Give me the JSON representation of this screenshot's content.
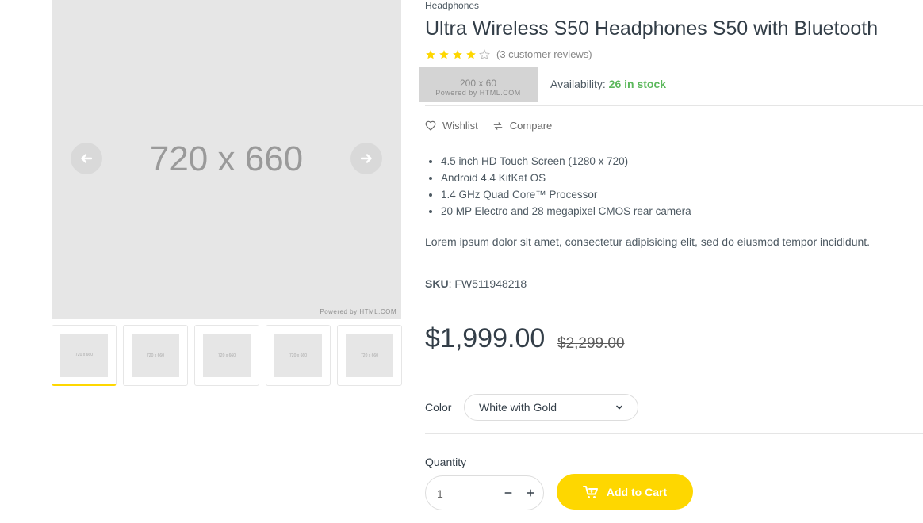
{
  "gallery": {
    "main_image_text": "720 x 660",
    "main_image_powered": "Powered by HTML.COM",
    "prev_icon": "arrow-left-icon",
    "next_icon": "arrow-right-icon",
    "thumbnails": [
      {
        "label": "720 x 660",
        "active": true
      },
      {
        "label": "720 x 660",
        "active": false
      },
      {
        "label": "720 x 660",
        "active": false
      },
      {
        "label": "720 x 660",
        "active": false
      },
      {
        "label": "720 x 660",
        "active": false
      }
    ]
  },
  "product": {
    "category": "Headphones",
    "title": "Ultra Wireless S50 Headphones S50 with Bluetooth",
    "rating": 4,
    "rating_max": 5,
    "reviews": "(3 customer reviews)",
    "brand_placeholder_size": "200 x 60",
    "brand_placeholder_powered": "Powered by HTML.COM",
    "availability_label": "Availability:",
    "availability_value": "26 in stock",
    "wishlist_label": "Wishlist",
    "compare_label": "Compare",
    "features": [
      "4.5 inch HD Touch Screen (1280 x 720)",
      "Android 4.4 KitKat OS",
      "1.4 GHz Quad Core™ Processor",
      "20 MP Electro and 28 megapixel CMOS rear camera"
    ],
    "description": "Lorem ipsum dolor sit amet, consectetur adipisicing elit, sed do eiusmod tempor incididunt.",
    "sku_label": "SKU",
    "sku_value": ": FW511948218",
    "price": "$1,999.00",
    "old_price": "$2,299.00",
    "color_label": "Color",
    "color_selected": "White with Gold",
    "quantity_label": "Quantity",
    "quantity_value": "1",
    "add_to_cart_label": "Add to Cart"
  },
  "colors": {
    "accent": "#fed700",
    "stock": "#5cb85c",
    "star": "#fed700"
  }
}
